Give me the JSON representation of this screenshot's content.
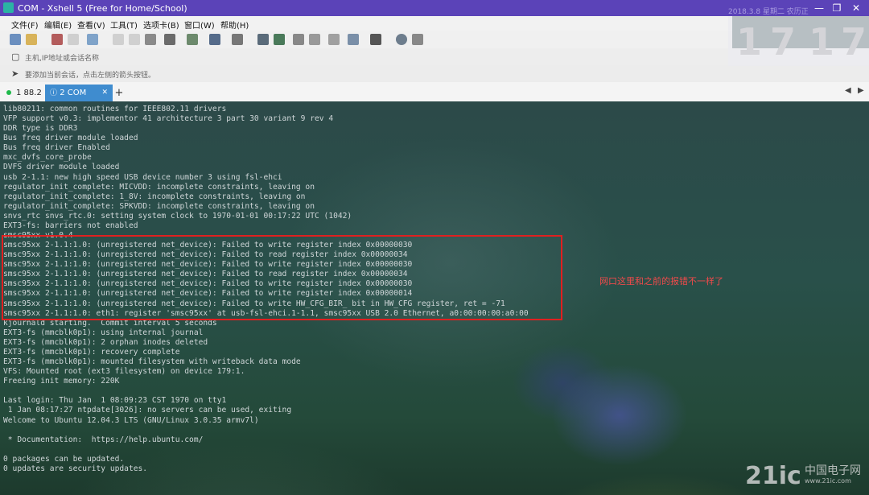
{
  "window": {
    "title": "COM - Xshell 5 (Free for Home/School)",
    "date": "2018.3.8   星期二  农历正"
  },
  "menu": [
    "文件(F)",
    "编辑(E)",
    "查看(V)",
    "工具(T)",
    "选项卡(B)",
    "窗口(W)",
    "帮助(H)"
  ],
  "address_bar": {
    "placeholder": "主机,IP地址或会话名称"
  },
  "hint_bar": {
    "text": "要添加当前会话，点击左侧的箭头按钮。"
  },
  "clock": {
    "digits": [
      "1",
      "7",
      "1",
      "7"
    ]
  },
  "tabs": [
    {
      "label": "1 88.2",
      "status": "connected"
    },
    {
      "label": "2 COM",
      "active": true
    }
  ],
  "terminal": {
    "lines": [
      "lib80211: common routines for IEEE802.11 drivers",
      "VFP support v0.3: implementor 41 architecture 3 part 30 variant 9 rev 4",
      "DDR type is DDR3",
      "Bus freq driver module loaded",
      "Bus freq driver Enabled",
      "mxc_dvfs_core_probe",
      "DVFS driver module loaded",
      "usb 2-1.1: new high speed USB device number 3 using fsl-ehci",
      "regulator_init_complete: MICVDD: incomplete constraints, leaving on",
      "regulator_init_complete: 1_8V: incomplete constraints, leaving on",
      "regulator_init_complete: SPKVDD: incomplete constraints, leaving on",
      "snvs_rtc snvs_rtc.0: setting system clock to 1970-01-01 00:17:22 UTC (1042)",
      "EXT3-fs: barriers not enabled",
      "smsc95xx v1.0.4",
      "smsc95xx 2-1.1:1.0: (unregistered net_device): Failed to write register index 0x00000030",
      "smsc95xx 2-1.1:1.0: (unregistered net_device): Failed to read register index 0x00000034",
      "smsc95xx 2-1.1:1.0: (unregistered net_device): Failed to write register index 0x00000030",
      "smsc95xx 2-1.1:1.0: (unregistered net_device): Failed to read register index 0x00000034",
      "smsc95xx 2-1.1:1.0: (unregistered net_device): Failed to write register index 0x00000030",
      "smsc95xx 2-1.1:1.0: (unregistered net_device): Failed to write register index 0x00000014",
      "smsc95xx 2-1.1:1.0: (unregistered net_device): Failed to write HW_CFG_BIR_ bit in HW_CFG register, ret = -71",
      "smsc95xx 2-1.1:1.0: eth1: register 'smsc95xx' at usb-fsl-ehci.1-1.1, smsc95xx USB 2.0 Ethernet, a0:00:00:00:a0:00",
      "kjournald starting.  Commit interval 5 seconds",
      "EXT3-fs (mmcblk0p1): using internal journal",
      "EXT3-fs (mmcblk0p1): 2 orphan inodes deleted",
      "EXT3-fs (mmcblk0p1): recovery complete",
      "EXT3-fs (mmcblk0p1): mounted filesystem with writeback data mode",
      "VFS: Mounted root (ext3 filesystem) on device 179:1.",
      "Freeing init memory: 220K",
      "",
      "Last login: Thu Jan  1 08:09:23 CST 1970 on tty1",
      " 1 Jan 08:17:27 ntpdate[3026]: no servers can be used, exiting",
      "Welcome to Ubuntu 12.04.3 LTS (GNU/Linux 3.0.35 armv7l)",
      "",
      " * Documentation:  https://help.ubuntu.com/",
      "",
      "0 packages can be updated.",
      "0 updates are security updates."
    ]
  },
  "annotation": {
    "note": "网口这里和之前的报错不一样了"
  },
  "watermark": {
    "logo": "21ic",
    "cn": "中国电子网",
    "url": "www.21ic.com"
  }
}
